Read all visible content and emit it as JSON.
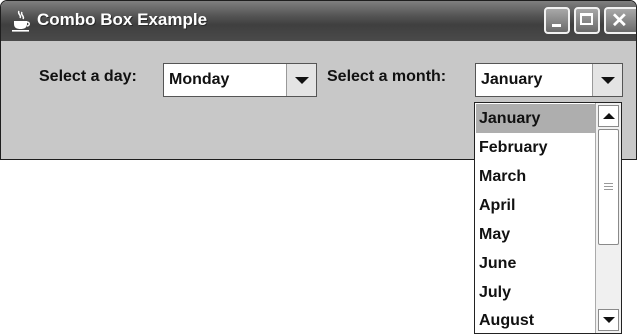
{
  "window": {
    "title": "Combo Box Example",
    "controls": {
      "minimize_icon": "minimize-icon",
      "maximize_icon": "maximize-icon",
      "close_icon": "close-icon",
      "close_glyph": "✕"
    }
  },
  "day_combo": {
    "label": "Select a day:",
    "selected": "Monday"
  },
  "month_combo": {
    "label": "Select a month:",
    "selected": "January",
    "expanded": true,
    "options": [
      "January",
      "February",
      "March",
      "April",
      "May",
      "June",
      "July",
      "August"
    ],
    "highlighted_index": 0
  },
  "colors": {
    "titlebar": "#4a4a4a",
    "window_body": "#c8c8c8",
    "selection": "#aeaeae"
  }
}
